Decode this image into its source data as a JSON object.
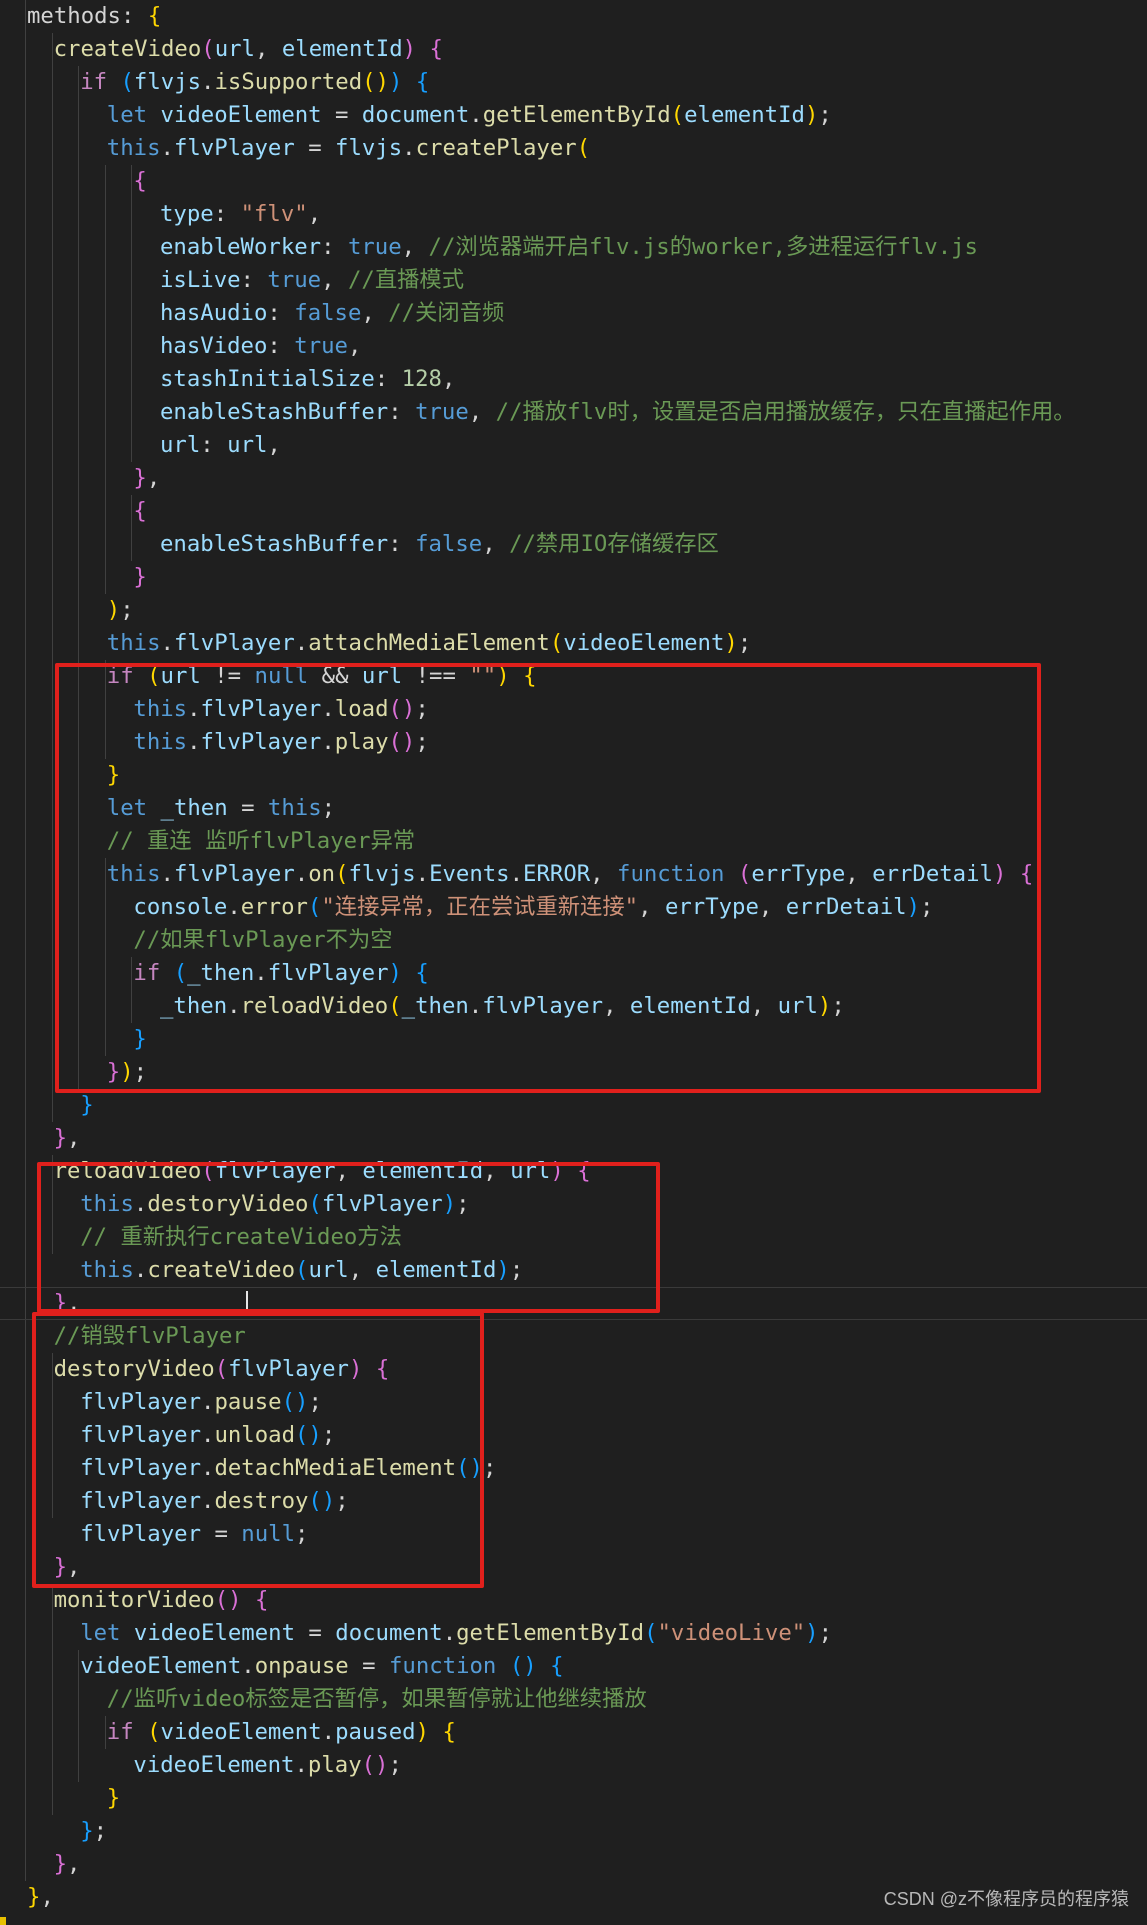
{
  "colors": {
    "background": "#1f1f1f",
    "keyword": "#569cd6",
    "control": "#c586c0",
    "function": "#dcdcaa",
    "variable": "#9cdcfe",
    "string": "#ce9178",
    "number": "#b5cea8",
    "comment": "#6a9955",
    "annotation_box": "#e0201c"
  },
  "code": [
    [
      [
        "plain",
        "methods: "
      ],
      [
        "b1",
        "{"
      ]
    ],
    [
      [
        "fn",
        "createVideo"
      ],
      [
        "b2",
        "("
      ],
      [
        "var",
        "url"
      ],
      [
        "plain",
        ", "
      ],
      [
        "var",
        "elementId"
      ],
      [
        "b2",
        ")"
      ],
      [
        "plain",
        " "
      ],
      [
        "b2",
        "{"
      ]
    ],
    [
      [
        "ctrl",
        "if"
      ],
      [
        "plain",
        " "
      ],
      [
        "b3",
        "("
      ],
      [
        "var",
        "flvjs"
      ],
      [
        "plain",
        "."
      ],
      [
        "fn",
        "isSupported"
      ],
      [
        "b1",
        "()"
      ],
      [
        "b3",
        ")"
      ],
      [
        "plain",
        " "
      ],
      [
        "b3",
        "{"
      ]
    ],
    [
      [
        "kw",
        "let"
      ],
      [
        "plain",
        " "
      ],
      [
        "var",
        "videoElement"
      ],
      [
        "plain",
        " = "
      ],
      [
        "var",
        "document"
      ],
      [
        "plain",
        "."
      ],
      [
        "fn",
        "getElementById"
      ],
      [
        "b1",
        "("
      ],
      [
        "var",
        "elementId"
      ],
      [
        "b1",
        ")"
      ],
      [
        "plain",
        ";"
      ]
    ],
    [
      [
        "kw",
        "this"
      ],
      [
        "plain",
        "."
      ],
      [
        "var",
        "flvPlayer"
      ],
      [
        "plain",
        " = "
      ],
      [
        "var",
        "flvjs"
      ],
      [
        "plain",
        "."
      ],
      [
        "fn",
        "createPlayer"
      ],
      [
        "b1",
        "("
      ]
    ],
    [
      [
        "b2",
        "{"
      ]
    ],
    [
      [
        "var",
        "type"
      ],
      [
        "plain",
        ": "
      ],
      [
        "str",
        "\"flv\""
      ],
      [
        "plain",
        ","
      ]
    ],
    [
      [
        "var",
        "enableWorker"
      ],
      [
        "plain",
        ": "
      ],
      [
        "kw",
        "true"
      ],
      [
        "plain",
        ", "
      ],
      [
        "cmt",
        "//浏览器端开启flv.js的worker,多进程运行flv.js"
      ]
    ],
    [
      [
        "var",
        "isLive"
      ],
      [
        "plain",
        ": "
      ],
      [
        "kw",
        "true"
      ],
      [
        "plain",
        ", "
      ],
      [
        "cmt",
        "//直播模式"
      ]
    ],
    [
      [
        "var",
        "hasAudio"
      ],
      [
        "plain",
        ": "
      ],
      [
        "kw",
        "false"
      ],
      [
        "plain",
        ", "
      ],
      [
        "cmt",
        "//关闭音频"
      ]
    ],
    [
      [
        "var",
        "hasVideo"
      ],
      [
        "plain",
        ": "
      ],
      [
        "kw",
        "true"
      ],
      [
        "plain",
        ","
      ]
    ],
    [
      [
        "var",
        "stashInitialSize"
      ],
      [
        "plain",
        ": "
      ],
      [
        "num",
        "128"
      ],
      [
        "plain",
        ","
      ]
    ],
    [
      [
        "var",
        "enableStashBuffer"
      ],
      [
        "plain",
        ": "
      ],
      [
        "kw",
        "true"
      ],
      [
        "plain",
        ", "
      ],
      [
        "cmt",
        "//播放flv时，设置是否启用播放缓存，只在直播起作用。"
      ]
    ],
    [
      [
        "var",
        "url"
      ],
      [
        "plain",
        ": "
      ],
      [
        "var",
        "url"
      ],
      [
        "plain",
        ","
      ]
    ],
    [
      [
        "b2",
        "}"
      ],
      [
        "plain",
        ","
      ]
    ],
    [
      [
        "b2",
        "{"
      ]
    ],
    [
      [
        "var",
        "enableStashBuffer"
      ],
      [
        "plain",
        ": "
      ],
      [
        "kw",
        "false"
      ],
      [
        "plain",
        ", "
      ],
      [
        "cmt",
        "//禁用IO存储缓存区"
      ]
    ],
    [
      [
        "b2",
        "}"
      ]
    ],
    [
      [
        "b1",
        ")"
      ],
      [
        "plain",
        ";"
      ]
    ],
    [
      [
        "kw",
        "this"
      ],
      [
        "plain",
        "."
      ],
      [
        "var",
        "flvPlayer"
      ],
      [
        "plain",
        "."
      ],
      [
        "fn",
        "attachMediaElement"
      ],
      [
        "b1",
        "("
      ],
      [
        "var",
        "videoElement"
      ],
      [
        "b1",
        ")"
      ],
      [
        "plain",
        ";"
      ]
    ],
    [
      [
        "ctrl",
        "if"
      ],
      [
        "plain",
        " "
      ],
      [
        "b1",
        "("
      ],
      [
        "var",
        "url"
      ],
      [
        "plain",
        " != "
      ],
      [
        "kw",
        "null"
      ],
      [
        "plain",
        " && "
      ],
      [
        "var",
        "url"
      ],
      [
        "plain",
        " !== "
      ],
      [
        "str",
        "\"\""
      ],
      [
        "b1",
        ")"
      ],
      [
        "plain",
        " "
      ],
      [
        "b1",
        "{"
      ]
    ],
    [
      [
        "kw",
        "this"
      ],
      [
        "plain",
        "."
      ],
      [
        "var",
        "flvPlayer"
      ],
      [
        "plain",
        "."
      ],
      [
        "fn",
        "load"
      ],
      [
        "b2",
        "()"
      ],
      [
        "plain",
        ";"
      ]
    ],
    [
      [
        "kw",
        "this"
      ],
      [
        "plain",
        "."
      ],
      [
        "var",
        "flvPlayer"
      ],
      [
        "plain",
        "."
      ],
      [
        "fn",
        "play"
      ],
      [
        "b2",
        "()"
      ],
      [
        "plain",
        ";"
      ]
    ],
    [
      [
        "b1",
        "}"
      ]
    ],
    [
      [
        "kw",
        "let"
      ],
      [
        "plain",
        " "
      ],
      [
        "var",
        "_then"
      ],
      [
        "plain",
        " = "
      ],
      [
        "kw",
        "this"
      ],
      [
        "plain",
        ";"
      ]
    ],
    [
      [
        "cmt",
        "// 重连 监听flvPlayer异常"
      ]
    ],
    [
      [
        "kw",
        "this"
      ],
      [
        "plain",
        "."
      ],
      [
        "var",
        "flvPlayer"
      ],
      [
        "plain",
        "."
      ],
      [
        "fn",
        "on"
      ],
      [
        "b1",
        "("
      ],
      [
        "var",
        "flvjs"
      ],
      [
        "plain",
        "."
      ],
      [
        "var",
        "Events"
      ],
      [
        "plain",
        "."
      ],
      [
        "var",
        "ERROR"
      ],
      [
        "plain",
        ", "
      ],
      [
        "kw",
        "function"
      ],
      [
        "plain",
        " "
      ],
      [
        "b2",
        "("
      ],
      [
        "var",
        "errType"
      ],
      [
        "plain",
        ", "
      ],
      [
        "var",
        "errDetail"
      ],
      [
        "b2",
        ")"
      ],
      [
        "plain",
        " "
      ],
      [
        "b2",
        "{"
      ]
    ],
    [
      [
        "var",
        "console"
      ],
      [
        "plain",
        "."
      ],
      [
        "fn",
        "error"
      ],
      [
        "b3",
        "("
      ],
      [
        "str",
        "\"连接异常，正在尝试重新连接\""
      ],
      [
        "plain",
        ", "
      ],
      [
        "var",
        "errType"
      ],
      [
        "plain",
        ", "
      ],
      [
        "var",
        "errDetail"
      ],
      [
        "b3",
        ")"
      ],
      [
        "plain",
        ";"
      ]
    ],
    [
      [
        "cmt",
        "//如果flvPlayer不为空"
      ]
    ],
    [
      [
        "ctrl",
        "if"
      ],
      [
        "plain",
        " "
      ],
      [
        "b3",
        "("
      ],
      [
        "var",
        "_then"
      ],
      [
        "plain",
        "."
      ],
      [
        "var",
        "flvPlayer"
      ],
      [
        "b3",
        ")"
      ],
      [
        "plain",
        " "
      ],
      [
        "b3",
        "{"
      ]
    ],
    [
      [
        "var",
        "_then"
      ],
      [
        "plain",
        "."
      ],
      [
        "fn",
        "reloadVideo"
      ],
      [
        "b1",
        "("
      ],
      [
        "var",
        "_then"
      ],
      [
        "plain",
        "."
      ],
      [
        "var",
        "flvPlayer"
      ],
      [
        "plain",
        ", "
      ],
      [
        "var",
        "elementId"
      ],
      [
        "plain",
        ", "
      ],
      [
        "var",
        "url"
      ],
      [
        "b1",
        ")"
      ],
      [
        "plain",
        ";"
      ]
    ],
    [
      [
        "b3",
        "}"
      ]
    ],
    [
      [
        "b2",
        "}"
      ],
      [
        "b1",
        ")"
      ],
      [
        "plain",
        ";"
      ]
    ],
    [
      [
        "b3",
        "}"
      ]
    ],
    [
      [
        "b2",
        "}"
      ],
      [
        "plain",
        ","
      ]
    ],
    [
      [
        "fn",
        "reloadVideo"
      ],
      [
        "b2",
        "("
      ],
      [
        "var",
        "flvPlayer"
      ],
      [
        "plain",
        ", "
      ],
      [
        "var",
        "elementId"
      ],
      [
        "plain",
        ", "
      ],
      [
        "var",
        "url"
      ],
      [
        "b2",
        ")"
      ],
      [
        "plain",
        " "
      ],
      [
        "b2",
        "{"
      ]
    ],
    [
      [
        "kw",
        "this"
      ],
      [
        "plain",
        "."
      ],
      [
        "fn",
        "destoryVideo"
      ],
      [
        "b3",
        "("
      ],
      [
        "var",
        "flvPlayer"
      ],
      [
        "b3",
        ")"
      ],
      [
        "plain",
        ";"
      ]
    ],
    [
      [
        "cmt",
        "// 重新执行createVideo方法"
      ]
    ],
    [
      [
        "kw",
        "this"
      ],
      [
        "plain",
        "."
      ],
      [
        "fn",
        "createVideo"
      ],
      [
        "b3",
        "("
      ],
      [
        "var",
        "url"
      ],
      [
        "plain",
        ", "
      ],
      [
        "var",
        "elementId"
      ],
      [
        "b3",
        ")"
      ],
      [
        "plain",
        ";"
      ]
    ],
    [
      [
        "b2",
        "}"
      ],
      [
        "plain",
        ","
      ]
    ],
    [
      [
        "cmt",
        "//销毁flvPlayer"
      ]
    ],
    [
      [
        "fn",
        "destoryVideo"
      ],
      [
        "b2",
        "("
      ],
      [
        "var",
        "flvPlayer"
      ],
      [
        "b2",
        ")"
      ],
      [
        "plain",
        " "
      ],
      [
        "b2",
        "{"
      ]
    ],
    [
      [
        "var",
        "flvPlayer"
      ],
      [
        "plain",
        "."
      ],
      [
        "fn",
        "pause"
      ],
      [
        "b3",
        "()"
      ],
      [
        "plain",
        ";"
      ]
    ],
    [
      [
        "var",
        "flvPlayer"
      ],
      [
        "plain",
        "."
      ],
      [
        "fn",
        "unload"
      ],
      [
        "b3",
        "()"
      ],
      [
        "plain",
        ";"
      ]
    ],
    [
      [
        "var",
        "flvPlayer"
      ],
      [
        "plain",
        "."
      ],
      [
        "fn",
        "detachMediaElement"
      ],
      [
        "b3",
        "()"
      ],
      [
        "plain",
        ";"
      ]
    ],
    [
      [
        "var",
        "flvPlayer"
      ],
      [
        "plain",
        "."
      ],
      [
        "fn",
        "destroy"
      ],
      [
        "b3",
        "()"
      ],
      [
        "plain",
        ";"
      ]
    ],
    [
      [
        "var",
        "flvPlayer"
      ],
      [
        "plain",
        " = "
      ],
      [
        "kw",
        "null"
      ],
      [
        "plain",
        ";"
      ]
    ],
    [
      [
        "b2",
        "}"
      ],
      [
        "plain",
        ","
      ]
    ],
    [
      [
        "fn",
        "monitorVideo"
      ],
      [
        "b2",
        "()"
      ],
      [
        "plain",
        " "
      ],
      [
        "b2",
        "{"
      ]
    ],
    [
      [
        "kw",
        "let"
      ],
      [
        "plain",
        " "
      ],
      [
        "var",
        "videoElement"
      ],
      [
        "plain",
        " = "
      ],
      [
        "var",
        "document"
      ],
      [
        "plain",
        "."
      ],
      [
        "fn",
        "getElementById"
      ],
      [
        "b3",
        "("
      ],
      [
        "str",
        "\"videoLive\""
      ],
      [
        "b3",
        ")"
      ],
      [
        "plain",
        ";"
      ]
    ],
    [
      [
        "var",
        "videoElement"
      ],
      [
        "plain",
        "."
      ],
      [
        "fn",
        "onpause"
      ],
      [
        "plain",
        " = "
      ],
      [
        "kw",
        "function"
      ],
      [
        "plain",
        " "
      ],
      [
        "b3",
        "()"
      ],
      [
        "plain",
        " "
      ],
      [
        "b3",
        "{"
      ]
    ],
    [
      [
        "cmt",
        "//监听video标签是否暂停，如果暂停就让他继续播放"
      ]
    ],
    [
      [
        "ctrl",
        "if"
      ],
      [
        "plain",
        " "
      ],
      [
        "b1",
        "("
      ],
      [
        "var",
        "videoElement"
      ],
      [
        "plain",
        "."
      ],
      [
        "var",
        "paused"
      ],
      [
        "b1",
        ")"
      ],
      [
        "plain",
        " "
      ],
      [
        "b1",
        "{"
      ]
    ],
    [
      [
        "var",
        "videoElement"
      ],
      [
        "plain",
        "."
      ],
      [
        "fn",
        "play"
      ],
      [
        "b2",
        "()"
      ],
      [
        "plain",
        ";"
      ]
    ],
    [
      [
        "b1",
        "}"
      ]
    ],
    [
      [
        "b3",
        "}"
      ],
      [
        "plain",
        ";"
      ]
    ],
    [
      [
        "b2",
        "}"
      ],
      [
        "plain",
        ","
      ]
    ],
    [
      [
        "b1",
        "}"
      ],
      [
        "plain",
        ","
      ]
    ]
  ],
  "watermark": "CSDN @z不像程序员的程序猿"
}
